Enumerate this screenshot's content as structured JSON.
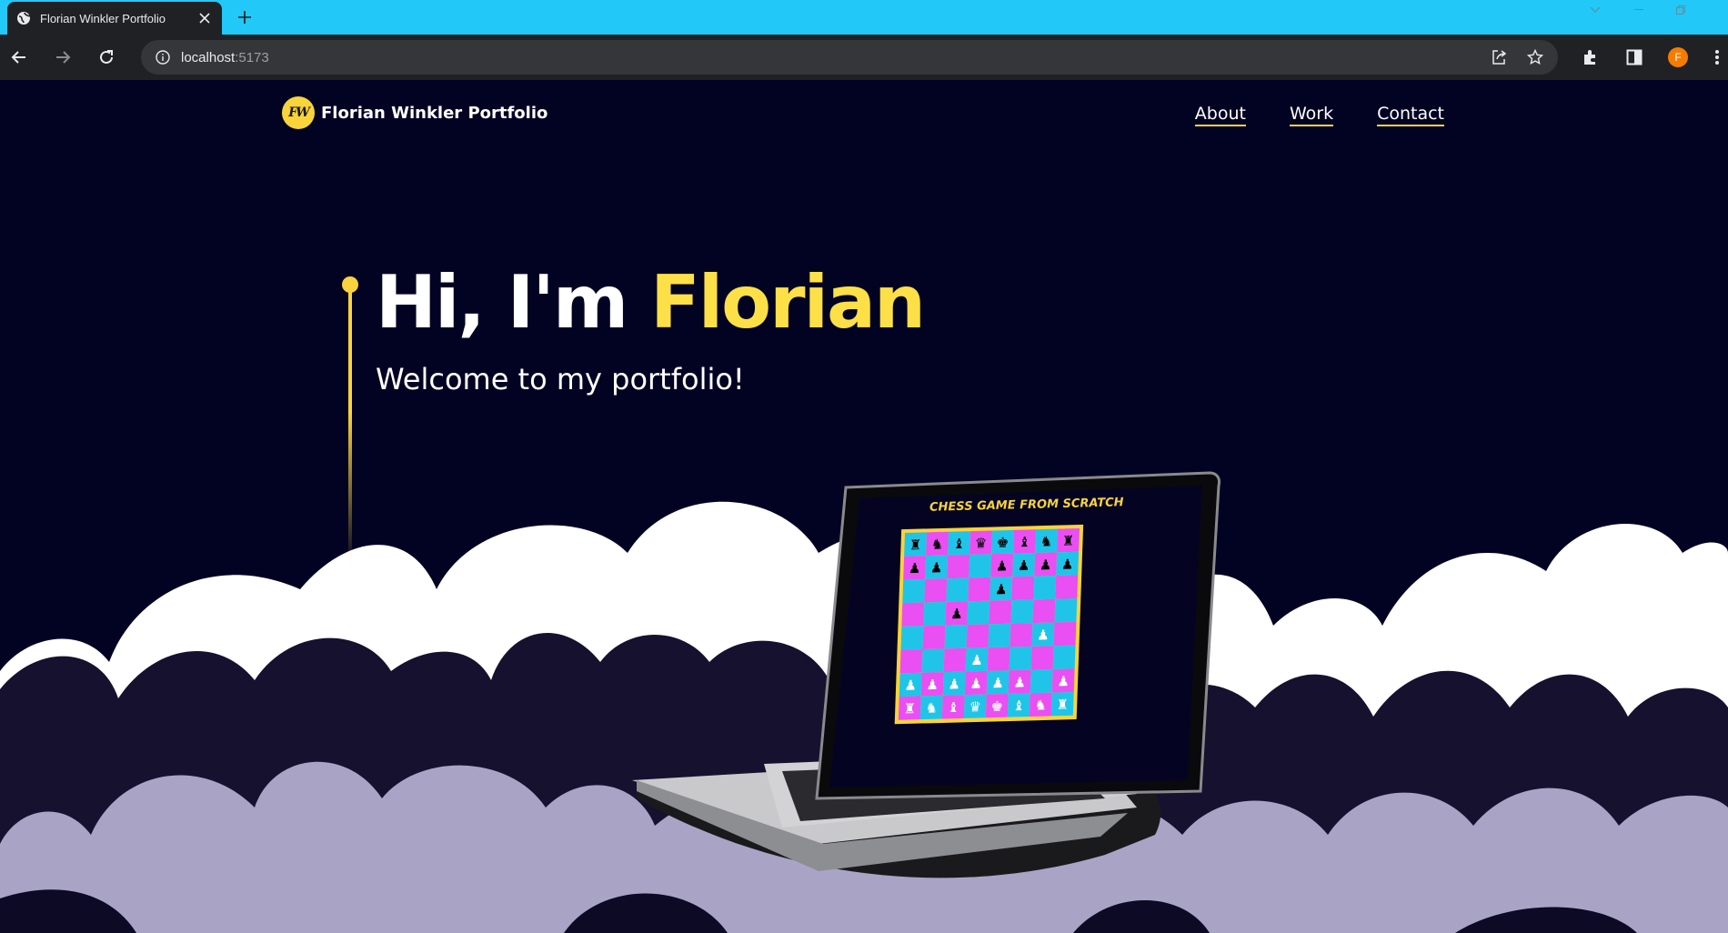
{
  "browser": {
    "tab_title": "Florian Winkler Portfolio",
    "url_host": "localhost",
    "url_port": ":5173",
    "profile_initial": "F"
  },
  "nav": {
    "logo_initials": "FW",
    "logo_text": "Florian Winkler  Portfolio",
    "links": [
      "About",
      "Work",
      "Contact"
    ]
  },
  "hero": {
    "greeting": "Hi, I'm ",
    "name": "Florian",
    "subtitle": "Welcome to my portfolio!"
  },
  "laptop_screen": {
    "caption": "CHESS GAME FROM SCRATCH"
  },
  "colors": {
    "background": "#020323",
    "accent_yellow": "#f9d33c",
    "chess_pink": "#e94ff2",
    "chess_cyan": "#20c4e8",
    "cloud_white": "#ffffff",
    "cloud_navy": "#15112f",
    "cloud_lavender": "#a9a4c6",
    "tab_bar": "#22c8f8"
  }
}
